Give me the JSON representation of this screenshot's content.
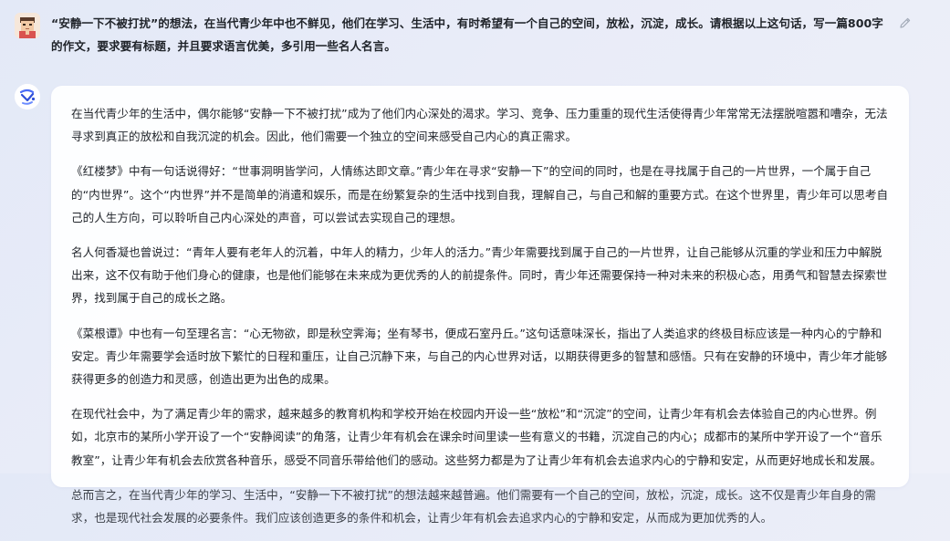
{
  "user": {
    "avatar_icon": "user-avatar-icon",
    "question": "“安静一下不被打扰”的想法，在当代青少年中也不鲜见，他们在学习、生活中，有时希望有一个自己的空间，放松，沉淀，成长。请根据以上这句话，写一篇800字的作文，要求要有标题，并且要求语言优美，多引用一些名人名言。",
    "edit_icon": "pencil-edit-icon"
  },
  "assistant": {
    "avatar_icon": "assistant-logo-icon",
    "paragraphs": [
      "在当代青少年的生活中，偶尔能够“安静一下不被打扰”成为了他们内心深处的渴求。学习、竞争、压力重重的现代生活使得青少年常常无法摆脱喧嚣和嘈杂，无法寻求到真正的放松和自我沉淀的机会。因此，他们需要一个独立的空间来感受自己内心的真正需求。",
      "《红楼梦》中有一句话说得好：“世事洞明皆学问，人情练达即文章。”青少年在寻求“安静一下”的空间的同时，也是在寻找属于自己的一片世界，一个属于自己的“内世界”。这个“内世界”并不是简单的消遣和娱乐，而是在纷繁复杂的生活中找到自我，理解自己，与自己和解的重要方式。在这个世界里，青少年可以思考自己的人生方向，可以聆听自己内心深处的声音，可以尝试去实现自己的理想。",
      "名人何香凝也曾说过：“青年人要有老年人的沉着，中年人的精力，少年人的活力。”青少年需要找到属于自己的一片世界，让自己能够从沉重的学业和压力中解脱出来，这不仅有助于他们身心的健康，也是他们能够在未来成为更优秀的人的前提条件。同时，青少年还需要保持一种对未来的积极心态，用勇气和智慧去探索世界，找到属于自己的成长之路。",
      "《菜根谭》中也有一句至理名言：“心无物欲，即是秋空霁海；坐有琴书，便成石室丹丘。”这句话意味深长，指出了人类追求的终极目标应该是一种内心的宁静和安定。青少年需要学会适时放下繁忙的日程和重压，让自己沉静下来，与自己的内心世界对话，以期获得更多的智慧和感悟。只有在安静的环境中，青少年才能够获得更多的创造力和灵感，创造出更为出色的成果。",
      "在现代社会中，为了满足青少年的需求，越来越多的教育机构和学校开始在校园内开设一些“放松”和“沉淀”的空间，让青少年有机会去体验自己的内心世界。例如，北京市的某所小学开设了一个“安静阅读”的角落，让青少年有机会在课余时间里读一些有意义的书籍，沉淀自己的内心；成都市的某所中学开设了一个“音乐教室”，让青少年有机会去欣赏各种音乐，感受不同音乐带给他们的感动。这些努力都是为了让青少年有机会去追求内心的宁静和安定，从而更好地成长和发展。",
      "总而言之，在当代青少年的学习、生活中，“安静一下不被打扰”的想法越来越普遍。他们需要有一个自己的空间，放松，沉淀，成长。这不仅是青少年自身的需求，也是现代社会发展的必要条件。我们应该创造更多的条件和机会，让青少年有机会去追求内心的宁静和安定，从而成为更加优秀的人。"
    ]
  }
}
